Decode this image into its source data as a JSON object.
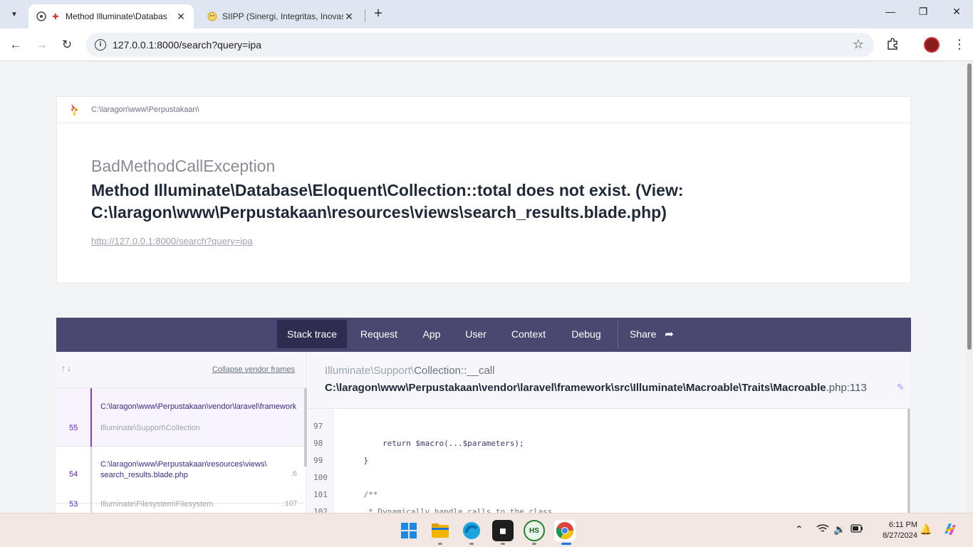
{
  "browser": {
    "tabs": [
      {
        "title": "Method Illuminate\\Databas",
        "active": true
      },
      {
        "title": "SIIPP (Sinergi, Integritas, Inovasi",
        "active": false
      }
    ],
    "url": "127.0.0.1:8000/search?query=ipa"
  },
  "error": {
    "app_path": "C:\\laragon\\www\\Perpustakaan\\",
    "exception_class": "BadMethodCallException",
    "message": "Method Illuminate\\Database\\Eloquent\\Collection::total does not exist. (View: C:\\laragon\\www\\Perpustakaan\\resources\\views\\search_results.blade.php)",
    "request_url": "http://127.0.0.1:8000/search?query=ipa"
  },
  "nav": {
    "items": [
      "Stack trace",
      "Request",
      "App",
      "User",
      "Context",
      "Debug"
    ],
    "share_label": "Share",
    "active": "Stack trace"
  },
  "frames": {
    "collapse_label": "Collapse vendor frames",
    "list": [
      {
        "number": "55",
        "file": "C:\\laragon\\www\\Perpustakaan\\vendor\\laravel\\framework",
        "class": "Illuminate\\Support\\Collection",
        "line": ""
      },
      {
        "number": "54",
        "file": "C:\\laragon\\www\\Perpustakaan\\resources\\views\\",
        "file2": "search_results.blade.php",
        "class": "",
        "line": ":6"
      },
      {
        "number": "53",
        "file": "",
        "class": "Illuminate\\Filesystem\\Filesystem",
        "line": ":107"
      }
    ]
  },
  "detail": {
    "class_prefix": "Illuminate\\Support\\",
    "class_name": "Collection::__call",
    "file_path": "C:\\laragon\\www\\Perpustakaan\\vendor\\laravel\\framework\\src\\Illuminate\\Macroable\\Traits\\Macroable",
    "file_ext_line": ".php:113",
    "code": [
      {
        "n": "97",
        "text": ""
      },
      {
        "n": "98",
        "text": "        return $macro(...$parameters);"
      },
      {
        "n": "99",
        "text": "    }"
      },
      {
        "n": "100",
        "text": ""
      },
      {
        "n": "101",
        "text": "    /**"
      },
      {
        "n": "102",
        "text": "     * Dynamically handle calls to the class."
      }
    ]
  },
  "taskbar": {
    "time": "6:11 PM",
    "date": "8/27/2024"
  }
}
